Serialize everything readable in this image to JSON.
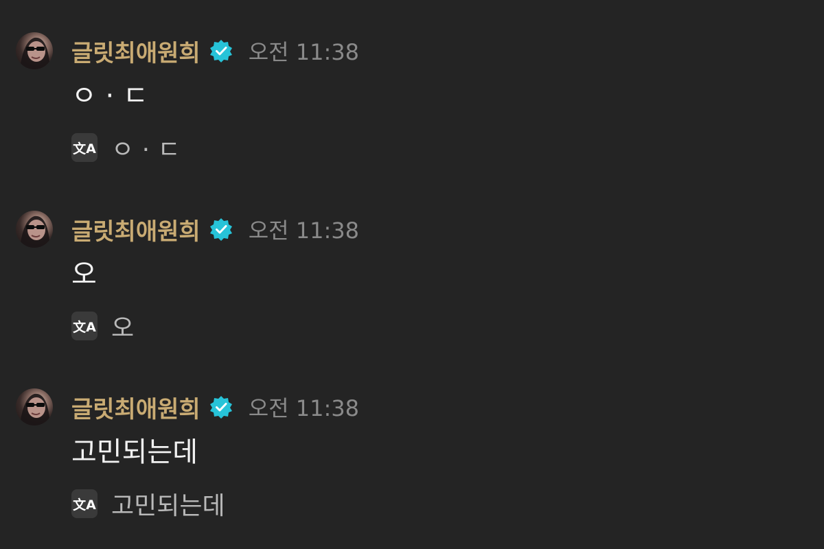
{
  "messages": [
    {
      "username": "글릿최애원희",
      "time": "오전 11:38",
      "text": "ㅇ · ㄷ",
      "translation": "ㅇ · ㄷ"
    },
    {
      "username": "글릿최애원희",
      "time": "오전 11:38",
      "text": "오",
      "translation": "오"
    },
    {
      "username": "글릿최애원희",
      "time": "오전 11:38",
      "text": "고민되는데",
      "translation": "고민되는데"
    }
  ],
  "icons": {
    "verified": "verified-badge-icon",
    "translate": "translate-icon",
    "translate_glyph": "文A"
  },
  "colors": {
    "background": "#242424",
    "username": "#c9ab73",
    "verified": "#27c3d8",
    "timestamp": "#8a8a8a",
    "message_text": "#f2f2f2",
    "translation_text": "#b9b9b9"
  }
}
